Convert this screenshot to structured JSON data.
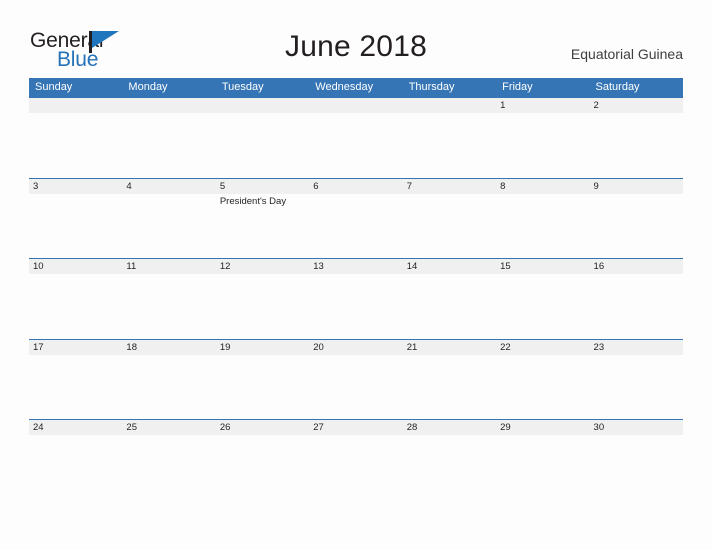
{
  "brand": {
    "name_part1": "General",
    "name_part2": "Blue",
    "flag_icon": "flag-icon",
    "primary_color": "#2572b8"
  },
  "header": {
    "title": "June 2018",
    "region": "Equatorial Guinea"
  },
  "calendar": {
    "month": "June",
    "year": "2018",
    "header_bg_color": "#3575b5",
    "day_band_color": "#f0f0f0",
    "weekdays": [
      "Sunday",
      "Monday",
      "Tuesday",
      "Wednesday",
      "Thursday",
      "Friday",
      "Saturday"
    ],
    "weeks": [
      [
        {
          "day": ""
        },
        {
          "day": ""
        },
        {
          "day": ""
        },
        {
          "day": ""
        },
        {
          "day": ""
        },
        {
          "day": "1"
        },
        {
          "day": "2"
        }
      ],
      [
        {
          "day": "3"
        },
        {
          "day": "4"
        },
        {
          "day": "5",
          "event": "President's Day"
        },
        {
          "day": "6"
        },
        {
          "day": "7"
        },
        {
          "day": "8"
        },
        {
          "day": "9"
        }
      ],
      [
        {
          "day": "10"
        },
        {
          "day": "11"
        },
        {
          "day": "12"
        },
        {
          "day": "13"
        },
        {
          "day": "14"
        },
        {
          "day": "15"
        },
        {
          "day": "16"
        }
      ],
      [
        {
          "day": "17"
        },
        {
          "day": "18"
        },
        {
          "day": "19"
        },
        {
          "day": "20"
        },
        {
          "day": "21"
        },
        {
          "day": "22"
        },
        {
          "day": "23"
        }
      ],
      [
        {
          "day": "24"
        },
        {
          "day": "25"
        },
        {
          "day": "26"
        },
        {
          "day": "27"
        },
        {
          "day": "28"
        },
        {
          "day": "29"
        },
        {
          "day": "30"
        }
      ]
    ]
  }
}
